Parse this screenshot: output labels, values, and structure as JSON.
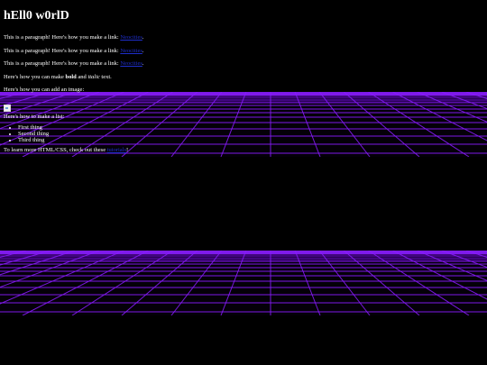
{
  "page": {
    "heading": "hEll0 w0rlD",
    "paragraphs": [
      {
        "text": "This is a paragraph! Here's how you make a link: ",
        "link": "Neocities",
        "tail": "."
      },
      {
        "text": "This is a paragraph! Here's how you make a link: ",
        "link": "Neocities",
        "tail": "."
      },
      {
        "text": "This is a paragraph! Here's how you make a link: ",
        "link": "Neocities",
        "tail": "."
      }
    ],
    "formatting": {
      "before": "Here's how you can make ",
      "bold": "bold",
      "middle": " and ",
      "italic": "italic",
      "after": " text."
    },
    "image_intro": "Here's how you can add an image:",
    "list_intro": "Here's how to make a list:",
    "list_items": [
      "First thing",
      "Second thing",
      "Third thing"
    ],
    "learn_more": {
      "before": "To learn more HTML/CSS, check out these ",
      "link": "tutorials",
      "after": "!"
    }
  },
  "colors": {
    "background": "#000000",
    "text": "#ffffff",
    "link": "#1e2ecc",
    "grid_line": "#8a1cff",
    "grid_glow": "#5a00b8"
  }
}
